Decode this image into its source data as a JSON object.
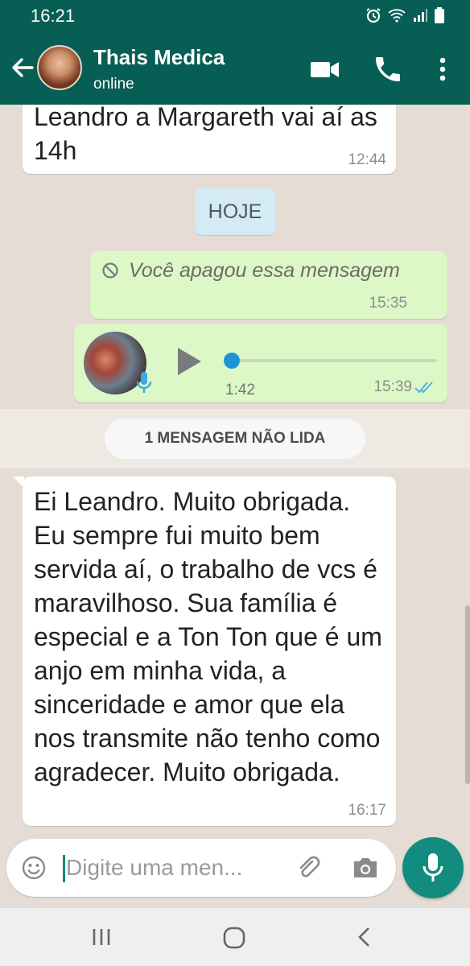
{
  "status_bar": {
    "time": "16:21"
  },
  "header": {
    "contact_name": "Thais Medica",
    "contact_status": "online"
  },
  "messages": [
    {
      "direction": "incoming",
      "text": "Leandro a Margareth vai aí as 14h",
      "time": "12:44"
    },
    {
      "direction": "outgoing",
      "deleted": true,
      "text": "Você apagou essa mensagem",
      "time": "15:35"
    },
    {
      "direction": "outgoing",
      "type": "voice",
      "duration": "1:42",
      "time": "15:39",
      "status": "read"
    },
    {
      "direction": "incoming",
      "text": "Ei Leandro. Muito obrigada. Eu sempre fui muito bem servida aí, o trabalho de vcs é maravilhoso. Sua família é especial e a Ton Ton que é um anjo em minha vida, a sinceridade e amor que ela nos transmite não tenho como agradecer. Muito obrigada.",
      "time": "16:17"
    }
  ],
  "date_divider": "HOJE",
  "unread_divider": "1 MENSAGEM NÃO LIDA",
  "composer": {
    "placeholder": "Digite uma men..."
  },
  "colors": {
    "header": "#075e54",
    "chat_background": "#e5ddd5",
    "outgoing_bubble": "#dcf8c6",
    "mic_button": "#128c7e",
    "date_chip": "#d4eaf4"
  },
  "icons": [
    "back-arrow-icon",
    "video-call-icon",
    "phone-icon",
    "more-vert-icon",
    "blocked-icon",
    "play-icon",
    "microphone-icon",
    "double-check-icon",
    "emoji-icon",
    "paperclip-icon",
    "camera-icon",
    "recent-apps-icon",
    "home-icon",
    "back-icon"
  ]
}
